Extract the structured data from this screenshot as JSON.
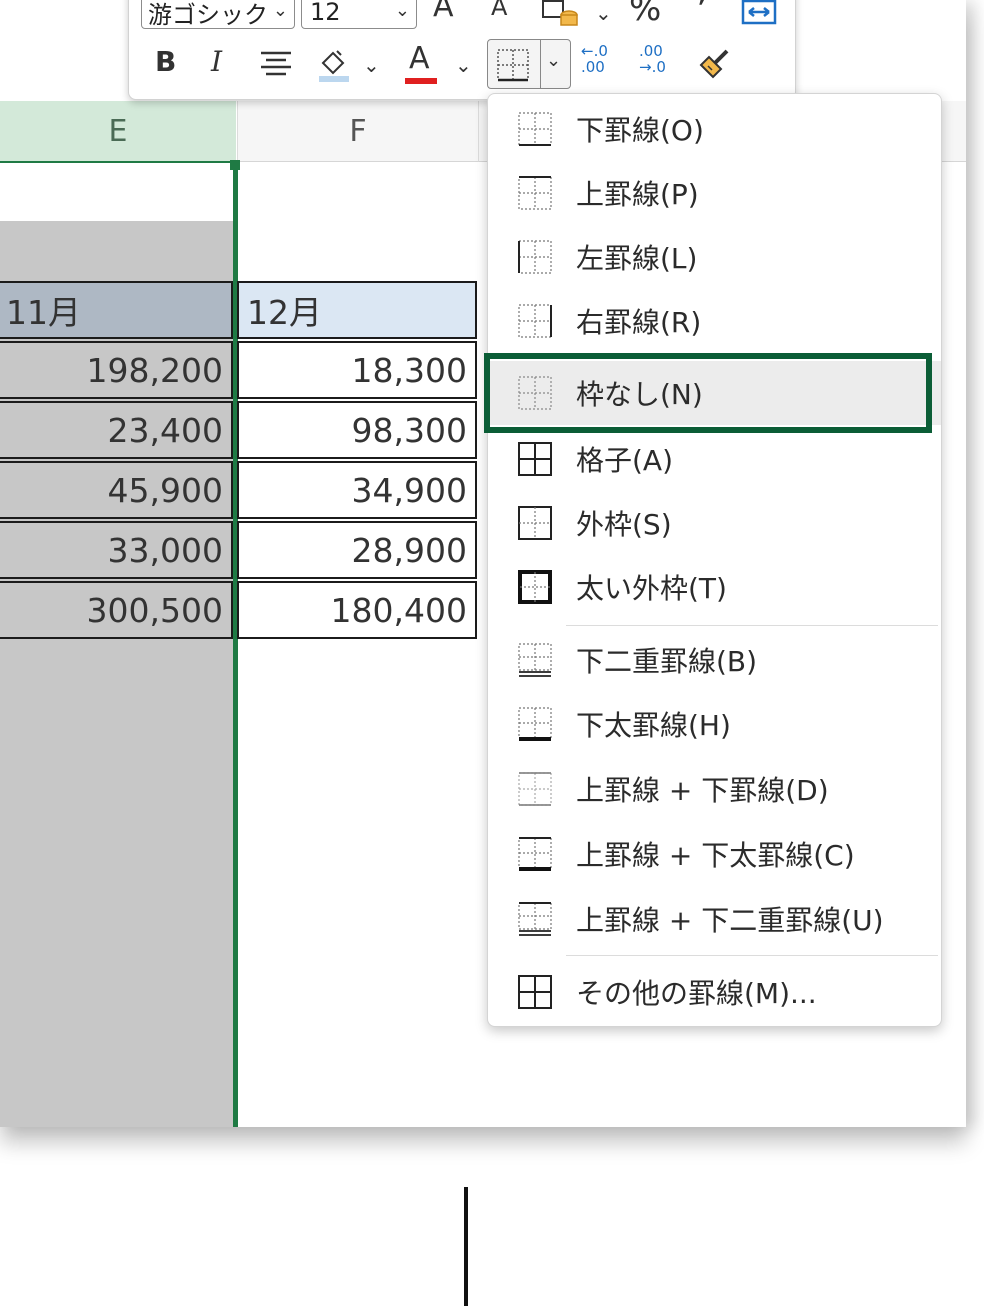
{
  "toolbar": {
    "font_name": "游ゴシック",
    "font_size": "12",
    "grow_font": "A",
    "shrink_font": "A",
    "percent": "%",
    "comma": "❜",
    "bold": "B",
    "italic": "I",
    "font_color_letter": "A",
    "increase_decimal": "←.0\n.00",
    "decrease_decimal": ".00\n→.0"
  },
  "sheet": {
    "columns": [
      "E",
      "F"
    ],
    "header_row": [
      "11月",
      "12月"
    ],
    "rows": [
      [
        "198,200",
        "18,300"
      ],
      [
        "23,400",
        "98,300"
      ],
      [
        "45,900",
        "34,900"
      ],
      [
        "33,000",
        "28,900"
      ],
      [
        "300,500",
        "180,400"
      ]
    ]
  },
  "border_menu": {
    "items": [
      {
        "label": "下罫線(O)",
        "icon": "bottom-border-icon"
      },
      {
        "label": "上罫線(P)",
        "icon": "top-border-icon"
      },
      {
        "label": "左罫線(L)",
        "icon": "left-border-icon"
      },
      {
        "label": "右罫線(R)",
        "icon": "right-border-icon"
      },
      {
        "label": "枠なし(N)",
        "icon": "no-border-icon"
      },
      {
        "label": "格子(A)",
        "icon": "all-borders-icon"
      },
      {
        "label": "外枠(S)",
        "icon": "outside-borders-icon"
      },
      {
        "label": "太い外枠(T)",
        "icon": "thick-outside-borders-icon"
      },
      {
        "label": "下二重罫線(B)",
        "icon": "bottom-double-border-icon"
      },
      {
        "label": "下太罫線(H)",
        "icon": "thick-bottom-border-icon"
      },
      {
        "label": "上罫線 + 下罫線(D)",
        "icon": "top-bottom-border-icon"
      },
      {
        "label": "上罫線 + 下太罫線(C)",
        "icon": "top-thick-bottom-border-icon"
      },
      {
        "label": "上罫線 + 下二重罫線(U)",
        "icon": "top-double-bottom-border-icon"
      },
      {
        "label": "その他の罫線(M)...",
        "icon": "more-borders-icon"
      }
    ],
    "highlighted": "枠なし(N)"
  },
  "colors": {
    "selection_green": "#1f7a44",
    "highlight_box": "#0b5d36",
    "font_color_bar": "#e02020",
    "fill_color_bar": "#bcd7ef"
  }
}
